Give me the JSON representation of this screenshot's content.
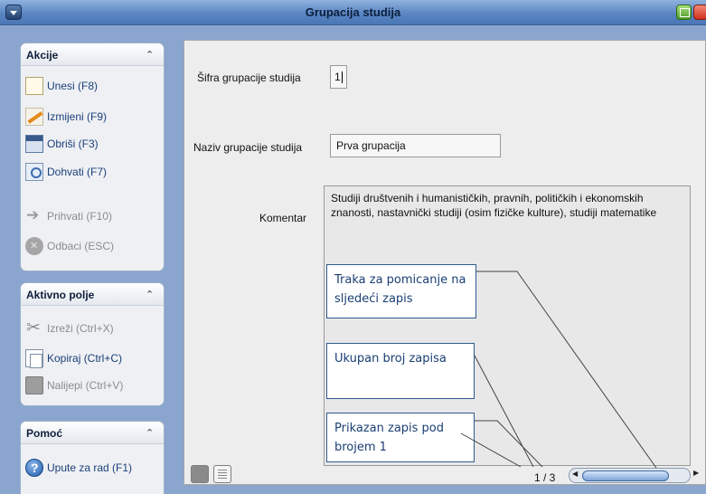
{
  "window": {
    "title": "Grupacija studija"
  },
  "sidebar": {
    "sections": [
      {
        "title": "Akcije",
        "items": [
          {
            "label": "Unesi (F8)",
            "icon": "new-record-icon",
            "enabled": true
          },
          {
            "label": "Izmijeni (F9)",
            "icon": "edit-icon",
            "enabled": true
          },
          {
            "label": "Obriši (F3)",
            "icon": "delete-icon",
            "enabled": true
          },
          {
            "label": "Dohvati (F7)",
            "icon": "fetch-icon",
            "enabled": true
          },
          {
            "label": "Prihvati (F10)",
            "icon": "accept-arrow-icon",
            "enabled": false
          },
          {
            "label": "Odbaci (ESC)",
            "icon": "cancel-icon",
            "enabled": false
          }
        ]
      },
      {
        "title": "Aktivno polje",
        "items": [
          {
            "label": "Izreži (Ctrl+X)",
            "icon": "scissors-icon",
            "enabled": false
          },
          {
            "label": "Kopiraj (Ctrl+C)",
            "icon": "copy-icon",
            "enabled": true
          },
          {
            "label": "Nalijepi (Ctrl+V)",
            "icon": "paste-icon",
            "enabled": false
          }
        ]
      },
      {
        "title": "Pomoć",
        "items": [
          {
            "label": "Upute za rad (F1)",
            "icon": "help-icon",
            "enabled": true
          }
        ]
      }
    ]
  },
  "form": {
    "sifra_label": "Šifra grupacije studija",
    "sifra_value": "1",
    "naziv_label": "Naziv grupacije studija",
    "naziv_value": "Prva grupacija",
    "komentar_label": "Komentar",
    "komentar_value": "Studiji društvenih i humanističkih, pravnih, političkih i ekonomskih znanosti, nastavnički studiji (osim fizičke kulture), studiji matematike"
  },
  "callouts": {
    "scroll_bar": "Traka za pomicanje na sljedeći zapis",
    "total_records": "Ukupan broj zapisa",
    "shown_record": "Prikazan zapis pod brojem 1"
  },
  "pager": {
    "text": "1 / 3",
    "current": 1,
    "total": 3
  },
  "colors": {
    "panel_bg": "#8aa6cf",
    "titlebar": "#5a86c4",
    "form_bg": "#ededed",
    "callout_border": "#2e5a8e"
  }
}
